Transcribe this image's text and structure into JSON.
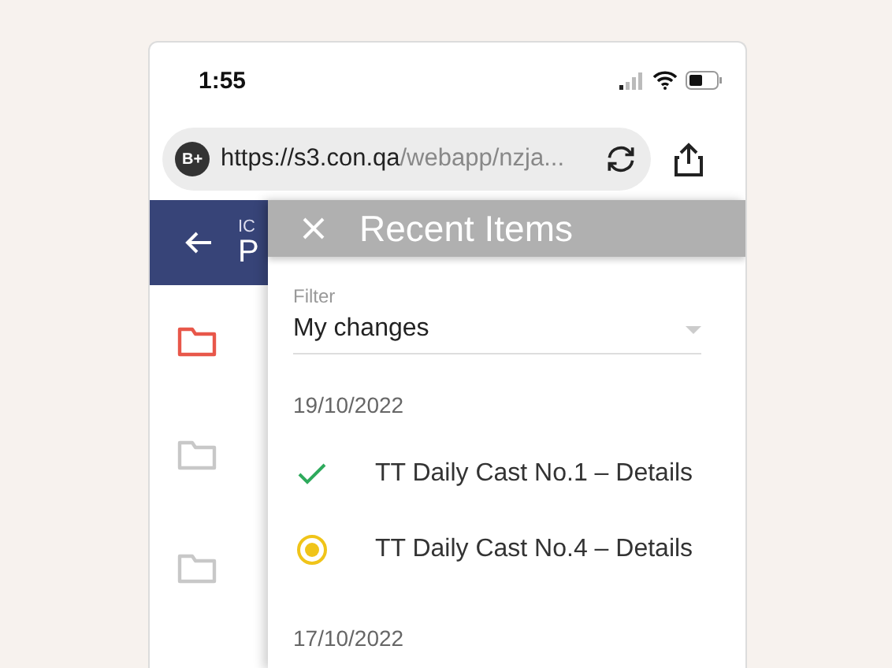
{
  "status_bar": {
    "time": "1:55"
  },
  "browser": {
    "badge": "B+",
    "url_host": "https://s3.con.qa",
    "url_path": "/webapp/nzja..."
  },
  "page_header": {
    "overline": "IC",
    "title": "P"
  },
  "folders": [
    {
      "color": "#e8574a"
    },
    {
      "color": "#c8c8c8"
    },
    {
      "color": "#c8c8c8"
    }
  ],
  "drawer": {
    "title": "Recent Items",
    "filter": {
      "label": "Filter",
      "value": "My changes"
    },
    "groups": [
      {
        "date": "19/10/2022",
        "items": [
          {
            "kind": "done",
            "label": "TT Daily Cast No.1 – Details"
          },
          {
            "kind": "pending",
            "label": "TT Daily Cast No.4 – Details"
          }
        ]
      },
      {
        "date": "17/10/2022"
      }
    ]
  }
}
